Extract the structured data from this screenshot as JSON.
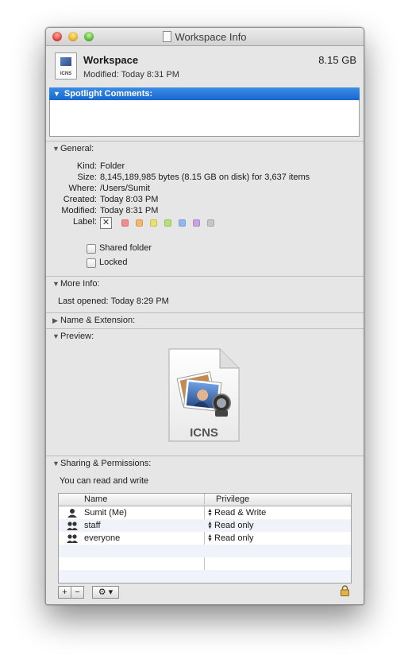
{
  "window": {
    "title": "Workspace Info"
  },
  "header": {
    "name": "Workspace",
    "size": "8.15 GB",
    "modified": "Modified: Today 8:31 PM",
    "icon_label": "ICNS"
  },
  "spotlight": {
    "label": "Spotlight Comments:"
  },
  "general": {
    "label": "General:",
    "rows": [
      {
        "key": "Kind:",
        "value": "Folder"
      },
      {
        "key": "Size:",
        "value": "8,145,189,985 bytes (8.15 GB on disk) for 3,637 items"
      },
      {
        "key": "Where:",
        "value": "/Users/Sumit"
      },
      {
        "key": "Created:",
        "value": "Today 8:03 PM"
      },
      {
        "key": "Modified:",
        "value": "Today 8:31 PM"
      }
    ],
    "label_key": "Label:",
    "label_none": "✕",
    "label_colors": [
      "#f28b8b",
      "#f5b86a",
      "#efe06a",
      "#b7df74",
      "#92b8f0",
      "#c9a2e3",
      "#c6c6c6"
    ],
    "shared_folder": "Shared folder",
    "locked": "Locked"
  },
  "more_info": {
    "label": "More Info:",
    "last_opened": "Last opened: Today 8:29 PM"
  },
  "name_ext": {
    "label": "Name & Extension:"
  },
  "preview": {
    "label": "Preview:",
    "file_label": "ICNS"
  },
  "sharing": {
    "label": "Sharing & Permissions:",
    "status": "You can read and write",
    "col_name": "Name",
    "col_privilege": "Privilege",
    "rows": [
      {
        "name": "Sumit (Me)",
        "privilege": "Read & Write"
      },
      {
        "name": "staff",
        "privilege": "Read only"
      },
      {
        "name": "everyone",
        "privilege": "Read only"
      }
    ],
    "add": "+",
    "remove": "−",
    "action": "⚙ ▾"
  }
}
